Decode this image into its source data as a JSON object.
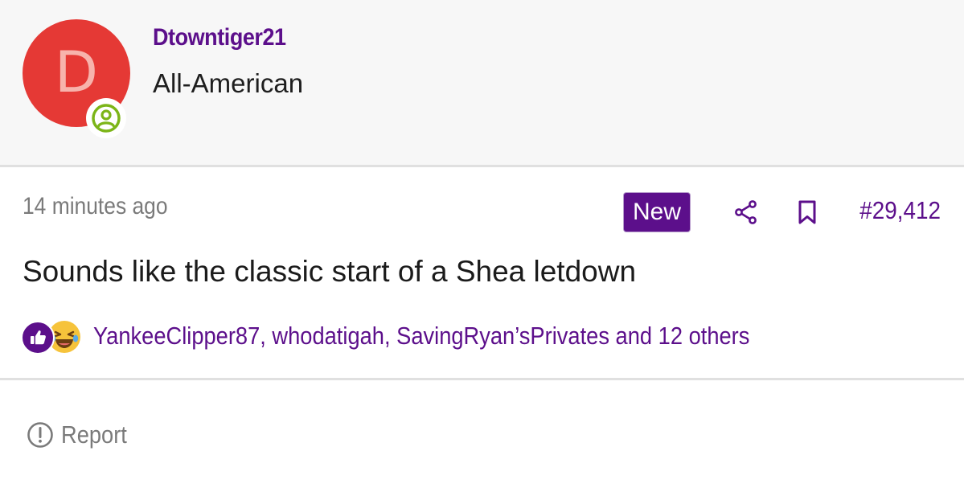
{
  "author": {
    "avatar_letter": "D",
    "avatar_color": "#e53935",
    "username": "Dtowntiger21",
    "title": "All-American",
    "status_icon": "online-user-icon",
    "status_color": "#7cb518"
  },
  "post": {
    "timestamp": "14 minutes ago",
    "new_badge": "New",
    "share_icon": "share-icon",
    "bookmark_icon": "bookmark-icon",
    "post_number": "#29,412",
    "body": "Sounds like the classic start of a Shea letdown"
  },
  "reactions": {
    "icons": [
      "thumbs-up-icon",
      "laughing-emoji-icon"
    ],
    "summary": "YankeeClipper87, whodatigah, SavingRyan’sPrivates and 12 others"
  },
  "footer": {
    "report_icon": "alert-circle-icon",
    "report_label": "Report"
  },
  "colors": {
    "accent": "#5c0f8b",
    "muted_text": "#7a7a7a",
    "header_bg": "#f7f7f7"
  }
}
